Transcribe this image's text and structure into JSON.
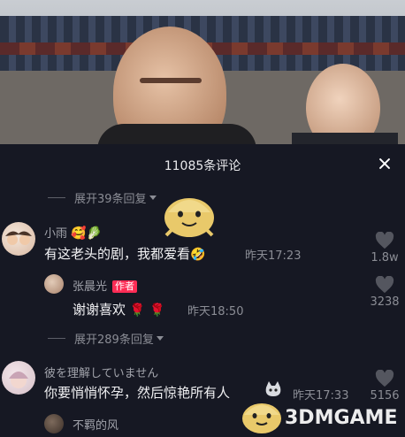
{
  "panel": {
    "title": "11085条评论"
  },
  "expand_top": {
    "label": "展开39条回复"
  },
  "comments": [
    {
      "user": "小雨",
      "text": "有这老头的剧，我都爱看",
      "time": "昨天17:23",
      "likes": "1.8w"
    },
    {
      "user": "张晨光",
      "badge": "作者",
      "text": "谢谢喜欢",
      "time": "昨天18:50",
      "likes": "3238"
    }
  ],
  "expand_mid": {
    "label": "展开289条回复"
  },
  "comment3": {
    "user": "彼を理解していません",
    "text": "你要悄悄怀孕，然后惊艳所有人",
    "time": "昨天17:33",
    "likes": "5156"
  },
  "comment4": {
    "user": "不羁的风"
  },
  "watermark": {
    "text": "3DMGAME"
  },
  "colors": {
    "background": "#161823",
    "accent": "#fe2c55",
    "muted": "#8b8d95"
  },
  "icons": [
    "close-icon",
    "heart-icon",
    "caret-down-icon",
    "rose-emoji",
    "laugh-emoji"
  ]
}
